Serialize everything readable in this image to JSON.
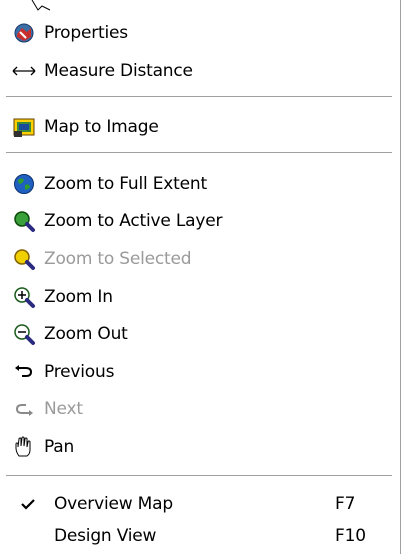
{
  "menu": {
    "items": [
      {
        "label": "Properties",
        "icon": "properties-icon"
      },
      {
        "label": "Measure Distance",
        "icon": "measure-distance-icon"
      },
      {
        "label": "Map to Image",
        "icon": "map-to-image-icon"
      },
      {
        "label": "Zoom to Full Extent",
        "icon": "globe-icon"
      },
      {
        "label": "Zoom to Active Layer",
        "icon": "magnifier-icon"
      },
      {
        "label": "Zoom to Selected",
        "icon": "magnifier-yellow-icon",
        "disabled": true
      },
      {
        "label": "Zoom In",
        "icon": "zoom-in-icon"
      },
      {
        "label": "Zoom Out",
        "icon": "zoom-out-icon"
      },
      {
        "label": "Previous",
        "icon": "back-arrow-icon"
      },
      {
        "label": "Next",
        "icon": "forward-arrow-icon",
        "disabled": true
      },
      {
        "label": "Pan",
        "icon": "hand-icon"
      },
      {
        "label": "Overview Map",
        "icon": "check-icon",
        "checked": true,
        "shortcut": "F7"
      },
      {
        "label": "Design View",
        "shortcut": "F10"
      }
    ]
  },
  "colors": {
    "separator": "#a0a0a0",
    "disabled_text": "#9a9a9a",
    "zoom_green": "#2e8b2e",
    "zoom_yellow": "#e6c200",
    "globe_blue": "#1f5fbf"
  }
}
